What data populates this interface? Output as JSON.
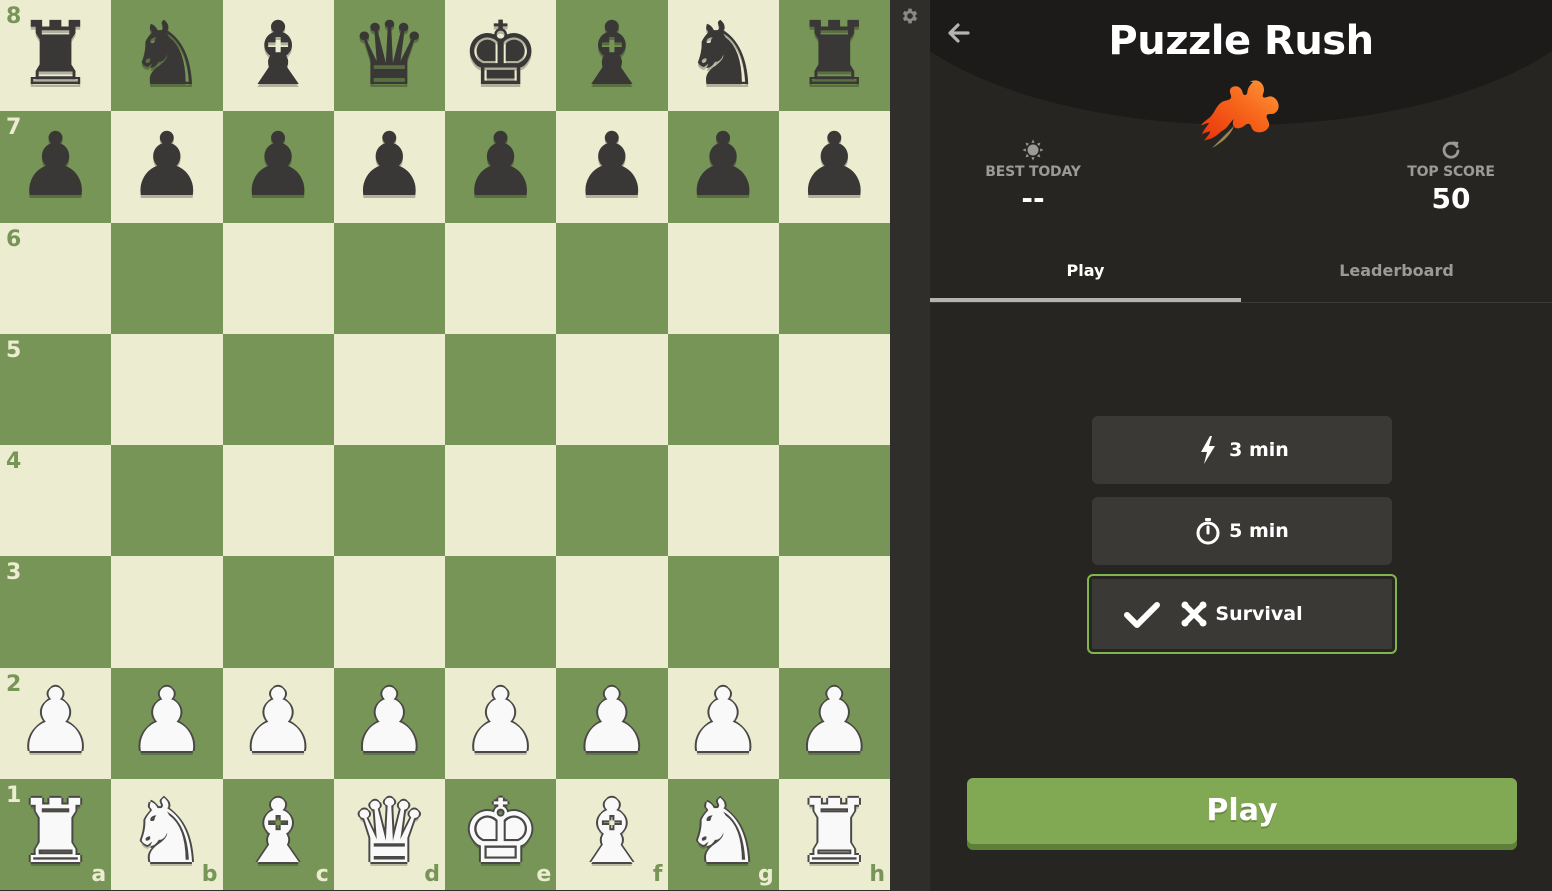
{
  "board": {
    "ranks": [
      "8",
      "7",
      "6",
      "5",
      "4",
      "3",
      "2",
      "1"
    ],
    "files": [
      "a",
      "b",
      "c",
      "d",
      "e",
      "f",
      "g",
      "h"
    ],
    "rows": [
      [
        {
          "p": "♜",
          "c": "black"
        },
        {
          "p": "♞",
          "c": "black"
        },
        {
          "p": "♝",
          "c": "black"
        },
        {
          "p": "♛",
          "c": "black"
        },
        {
          "p": "♚",
          "c": "black"
        },
        {
          "p": "♝",
          "c": "black"
        },
        {
          "p": "♞",
          "c": "black"
        },
        {
          "p": "♜",
          "c": "black"
        }
      ],
      [
        {
          "p": "♟",
          "c": "black"
        },
        {
          "p": "♟",
          "c": "black"
        },
        {
          "p": "♟",
          "c": "black"
        },
        {
          "p": "♟",
          "c": "black"
        },
        {
          "p": "♟",
          "c": "black"
        },
        {
          "p": "♟",
          "c": "black"
        },
        {
          "p": "♟",
          "c": "black"
        },
        {
          "p": "♟",
          "c": "black"
        }
      ],
      [
        null,
        null,
        null,
        null,
        null,
        null,
        null,
        null
      ],
      [
        null,
        null,
        null,
        null,
        null,
        null,
        null,
        null
      ],
      [
        null,
        null,
        null,
        null,
        null,
        null,
        null,
        null
      ],
      [
        null,
        null,
        null,
        null,
        null,
        null,
        null,
        null
      ],
      [
        {
          "p": "♟",
          "c": "white"
        },
        {
          "p": "♟",
          "c": "white"
        },
        {
          "p": "♟",
          "c": "white"
        },
        {
          "p": "♟",
          "c": "white"
        },
        {
          "p": "♟",
          "c": "white"
        },
        {
          "p": "♟",
          "c": "white"
        },
        {
          "p": "♟",
          "c": "white"
        },
        {
          "p": "♟",
          "c": "white"
        }
      ],
      [
        {
          "p": "♜",
          "c": "white"
        },
        {
          "p": "♞",
          "c": "white"
        },
        {
          "p": "♝",
          "c": "white"
        },
        {
          "p": "♛",
          "c": "white"
        },
        {
          "p": "♚",
          "c": "white"
        },
        {
          "p": "♝",
          "c": "white"
        },
        {
          "p": "♞",
          "c": "white"
        },
        {
          "p": "♜",
          "c": "white"
        }
      ]
    ],
    "colors": {
      "light": "#ebecd0",
      "dark": "#779556"
    }
  },
  "panel": {
    "title": "Puzzle Rush",
    "best_today_label": "BEST TODAY",
    "best_today_value": "--",
    "top_score_label": "TOP SCORE",
    "top_score_value": "50",
    "tabs": {
      "play": "Play",
      "leaderboard": "Leaderboard"
    },
    "modes": {
      "three": "3 min",
      "five": "5 min",
      "survival": "Survival"
    },
    "selected_mode": "Survival",
    "play_button": "Play",
    "accent": "#81b64c"
  }
}
